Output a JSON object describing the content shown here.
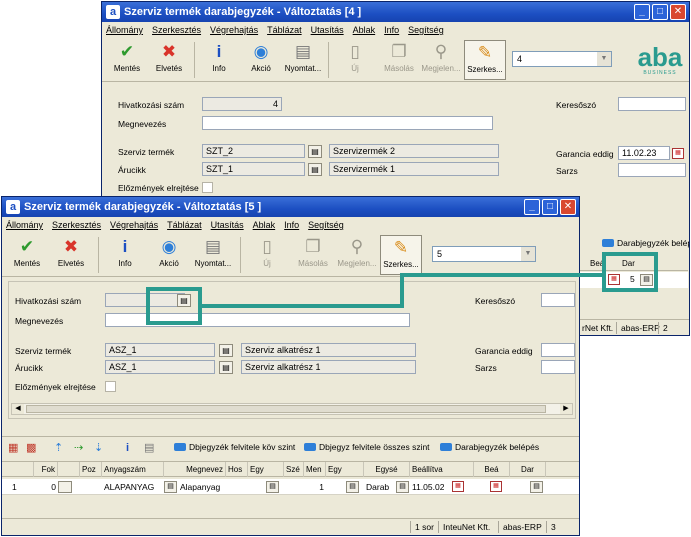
{
  "back": {
    "title": "Szerviz termék darabjegyzék - Változtatás [4   ]",
    "menu": [
      "Állomány",
      "Szerkesztés",
      "Végrehajtás",
      "Táblázat",
      "Utasítás",
      "Ablak",
      "Info",
      "Segítség"
    ],
    "toolbar": {
      "mentes": "Mentés",
      "elvetes": "Elvetés",
      "info": "Info",
      "akcio": "Akció",
      "nyomtat": "Nyomtat...",
      "uj": "Új",
      "masolas": "Másolás",
      "megjelen": "Megjelen...",
      "szerkes": "Szerkes...",
      "record_value": "4"
    },
    "brand": "aba",
    "brand_sub": "BUSINESS",
    "labels": {
      "hivatkozasi_szam": "Hivatkozási szám",
      "megnevezes": "Megnevezés",
      "szerviz_termek": "Szerviz termék",
      "arucikk": "Árucikk",
      "elozmenyek": "Előzmények elrejtése",
      "kereso": "Keresőszó",
      "garancia": "Garancia eddig",
      "sarzs": "Sarzs"
    },
    "values": {
      "hivatkozasi_szam": "4",
      "szerviz_termek_code": "SZT_2",
      "szerviz_termek_name": "Szervizermék 2",
      "arucikk_code": "SZT_1",
      "arucikk_name": "Szervizermék 1",
      "garancia": "11.02.23"
    },
    "partial_grid": {
      "darabjegyzek_label": "Darabjegyzék belépés",
      "col_bea": "Beá",
      "col_dar": "Dar",
      "dar_value": "5"
    },
    "status": [
      "rNet Kft.",
      "abas-ERP",
      "2"
    ]
  },
  "front": {
    "title": "Szerviz termék darabjegyzék - Változtatás [5   ]",
    "menu": [
      "Állomány",
      "Szerkesztés",
      "Végrehajtás",
      "Táblázat",
      "Utasítás",
      "Ablak",
      "Info",
      "Segítség"
    ],
    "toolbar": {
      "mentes": "Mentés",
      "elvetes": "Elvetés",
      "info": "Info",
      "akcio": "Akció",
      "nyomtat": "Nyomtat...",
      "uj": "Új",
      "masolas": "Másolás",
      "megjelen": "Megjelen...",
      "szerkes": "Szerkes...",
      "record_value": "5"
    },
    "labels": {
      "hivatkozasi_szam": "Hivatkozási szám",
      "megnevezes": "Megnevezés",
      "szerviz_termek": "Szerviz termék",
      "arucikk": "Árucikk",
      "elozmenyek": "Előzmények elrejtése",
      "kereso": "Keresőszó",
      "garancia": "Garancia eddig",
      "sarzs": "Sarzs"
    },
    "values": {
      "szerviz_termek_code": "ASZ_1",
      "szerviz_termek_name": "Szerviz alkatrész 1",
      "arucikk_code": "ASZ_1",
      "arucikk_name": "Szerviz alkatrész 1"
    },
    "grid_toolbar": {
      "btn1": "Dbjegyzék felvitele köv szint",
      "btn2": "Dbjegyz felvitele összes szint",
      "btn3": "Darabjegyzék belépés"
    },
    "columns": [
      "Fok",
      "Poz",
      "Anyagszám",
      "Megnevez",
      "Hos",
      "Egy",
      "Szé",
      "Men",
      "Egy",
      "Egysé",
      "Beállítva",
      "Beá",
      "Dar"
    ],
    "rows": [
      {
        "n": "1",
        "fok": "0",
        "anyagszam": "ALAPANYAG",
        "megnevez": "Alapanyag",
        "men": "1",
        "egyseg": "Darab",
        "beallitva": "11.05.02"
      }
    ],
    "status": [
      "1 sor",
      "InteuNet Kft.",
      "abas-ERP",
      "3"
    ]
  },
  "colors": {
    "title_bar": "#1c4fc2",
    "highlight": "#2a9b8f",
    "close_button": "#d9482f",
    "accent_blue": "#2e7fd8"
  }
}
